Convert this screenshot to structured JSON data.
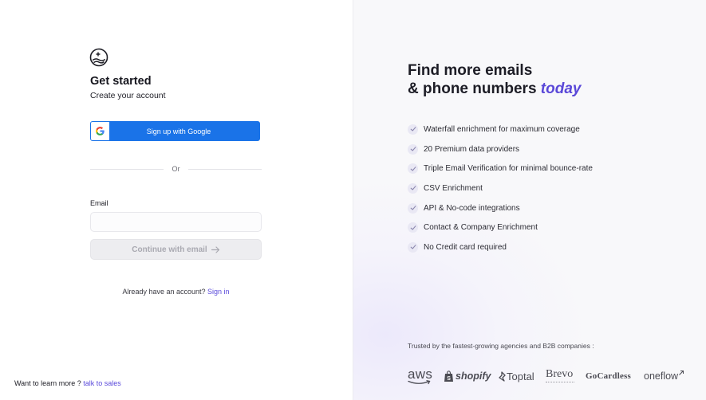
{
  "left": {
    "title": "Get started",
    "subtitle": "Create your account",
    "google_button_label": "Sign up with Google",
    "divider_label": "Or",
    "email_label": "Email",
    "email_value": "",
    "email_placeholder": "",
    "continue_label": "Continue with email",
    "signin_prompt": "Already have an account?",
    "signin_link": "Sign in",
    "learn_prompt": "Want to learn more ?",
    "sales_link": "talk to sales"
  },
  "right": {
    "headline_line1": "Find more emails",
    "headline_line2_prefix": "& phone numbers ",
    "headline_accent": "today",
    "features": [
      "Waterfall enrichment for maximum coverage",
      "20 Premium data providers",
      "Triple Email Verification for minimal bounce-rate",
      "CSV Enrichment",
      "API & No-code integrations",
      "Contact & Company Enrichment",
      "No Credit card required"
    ],
    "trusted_text": "Trusted by the fastest-growing agencies and B2B companies :",
    "brands": {
      "aws": "aws",
      "shopify": "shopify",
      "toptal": "Toptal",
      "brevo": "Brevo",
      "gocardless": "GoCardless",
      "oneflow": "oneflow"
    }
  },
  "colors": {
    "google_blue": "#1a73e8",
    "accent_purple": "#5a48d8",
    "link_purple": "#5b4bdb"
  }
}
